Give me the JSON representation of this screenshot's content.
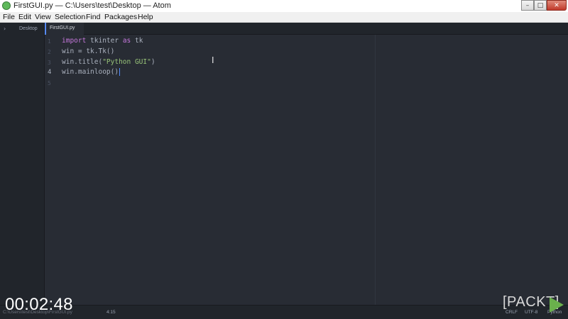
{
  "window": {
    "title": "FirstGUI.py — C:\\Users\\test\\Desktop — Atom",
    "minimize_glyph": "–",
    "maximize_glyph": "□",
    "close_glyph": "✕"
  },
  "menu": [
    "File",
    "Edit",
    "View",
    "Selection",
    "Find",
    "Packages",
    "Help"
  ],
  "tree_view": {
    "chevron": "›",
    "folder": "Desktop"
  },
  "tabs": [
    {
      "label": "FirstGUI.py",
      "active": true
    }
  ],
  "editor": {
    "line_numbers": [
      "1",
      "2",
      "3",
      "4",
      "5"
    ],
    "active_line": "4",
    "code": {
      "line1_kw1": "import",
      "line1_mid": " tkinter ",
      "line1_kw2": "as",
      "line1_end": " tk",
      "line2": "win = tk.Tk()",
      "line3_pre": "win.title(",
      "line3_str": "\"Python GUI\"",
      "line3_post": ")",
      "line4_pre": "win.mainloop(",
      "line4_post": ")"
    },
    "ibeam_glyph": "I"
  },
  "status_bar": {
    "path": "C:\\Users\\test\\Desktop\\FirstGUI.py",
    "cursor_position": "4:15",
    "line_ending": "CRLF",
    "encoding": "UTF-8",
    "grammar": "Python"
  },
  "overlay": {
    "timer": "00:02:48",
    "logo_text": "[PACKT]"
  },
  "colors": {
    "editor_bg": "#282c34",
    "panel_bg": "#21252b",
    "keyword": "#c678dd",
    "string": "#98c379",
    "text": "#abb2bf",
    "accent": "#568af2"
  }
}
